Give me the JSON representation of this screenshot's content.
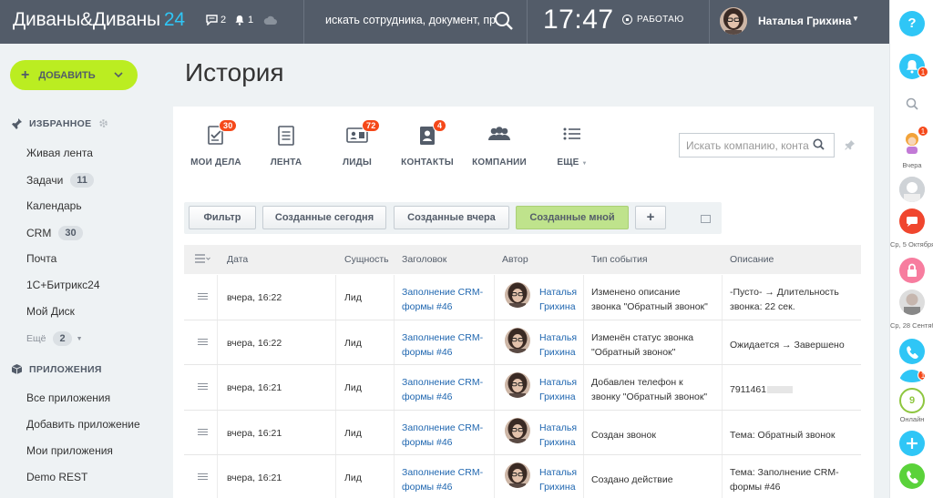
{
  "header": {
    "logo_text": "Диваны&Диваны",
    "logo_number": "24",
    "messages_count": "2",
    "notifications_count": "1",
    "search_placeholder": "искать сотрудника, документ, пр",
    "time": "17:47",
    "work_status": "РАБОТАЮ",
    "user_name": "Наталья Грихина",
    "help_label": "?"
  },
  "right_rail": {
    "notification_badge": "1",
    "chat_badge": "1",
    "label_yesterday": "Вчера",
    "label_date1": "Ср, 5 Октября",
    "label_date2": "Ср, 28 Сентября",
    "online_count": "9",
    "online_label": "Онлайн",
    "bottom_badge": "1"
  },
  "left_menu": {
    "add_label": "ДОБАВИТЬ",
    "favorites_label": "ИЗБРАННОЕ",
    "items": [
      {
        "label": "Живая лента",
        "count": ""
      },
      {
        "label": "Задачи",
        "count": "11"
      },
      {
        "label": "Календарь",
        "count": ""
      },
      {
        "label": "CRM",
        "count": "30"
      },
      {
        "label": "Почта",
        "count": ""
      },
      {
        "label": "1С+Битрикс24",
        "count": ""
      },
      {
        "label": "Мой Диск",
        "count": ""
      }
    ],
    "more_label": "Ещё",
    "more_count": "2",
    "apps_label": "ПРИЛОЖЕНИЯ",
    "apps": [
      {
        "label": "Все приложения"
      },
      {
        "label": "Добавить приложение"
      },
      {
        "label": "Мои приложения"
      },
      {
        "label": "Demo REST"
      }
    ]
  },
  "page_title": "История",
  "toolbar": [
    {
      "label": "МОИ ДЕЛА",
      "badge": "30",
      "icon": "tasks-icon"
    },
    {
      "label": "ЛЕНТА",
      "badge": "",
      "icon": "feed-icon"
    },
    {
      "label": "ЛИДЫ",
      "badge": "72",
      "icon": "leads-icon"
    },
    {
      "label": "КОНТАКТЫ",
      "badge": "4",
      "icon": "contacts-icon"
    },
    {
      "label": "КОМПАНИИ",
      "badge": "",
      "icon": "companies-icon"
    },
    {
      "label": "ЕЩЕ",
      "badge": "",
      "icon": "list-icon"
    }
  ],
  "company_search_placeholder": "Искать компанию, конта",
  "filters": [
    {
      "label": "Фильтр"
    },
    {
      "label": "Созданные сегодня"
    },
    {
      "label": "Созданные вчера"
    },
    {
      "label": "Созданные мной",
      "active": true
    }
  ],
  "filter_add_label": "+",
  "grid": {
    "columns": [
      "Дата",
      "Сущность",
      "Заголовок",
      "Автор",
      "Тип события",
      "Описание"
    ],
    "rows": [
      {
        "date": "вчера, 16:22",
        "entity": "Лид",
        "title_1": "Заполнение CRM-",
        "title_2": "формы #46",
        "author_1": "Наталья",
        "author_2": "Грихина",
        "event_1": "Изменено описание",
        "event_2": "звонка \"Обратный звонок\"",
        "desc_1": "-Пусто- → Длительность",
        "desc_2": "звонка: 22 сек."
      },
      {
        "date": "вчера, 16:22",
        "entity": "Лид",
        "title_1": "Заполнение CRM-",
        "title_2": "формы #46",
        "author_1": "Наталья",
        "author_2": "Грихина",
        "event_1": "Изменён статус звонка",
        "event_2": "\"Обратный звонок\"",
        "desc_1": "Ожидается → Завершено",
        "desc_2": ""
      },
      {
        "date": "вчера, 16:21",
        "entity": "Лид",
        "title_1": "Заполнение CRM-",
        "title_2": "формы #46",
        "author_1": "Наталья",
        "author_2": "Грихина",
        "event_1": "Добавлен телефон к",
        "event_2": "звонку \"Обратный звонок\"",
        "desc_1": "7911461",
        "desc_2": ""
      },
      {
        "date": "вчера, 16:21",
        "entity": "Лид",
        "title_1": "Заполнение CRM-",
        "title_2": "формы #46",
        "author_1": "Наталья",
        "author_2": "Грихина",
        "event_1": "Создан звонок",
        "event_2": "",
        "desc_1": "Тема: Обратный звонок",
        "desc_2": ""
      },
      {
        "date": "вчера, 16:21",
        "entity": "Лид",
        "title_1": "Заполнение CRM-",
        "title_2": "формы #46",
        "author_1": "Наталья",
        "author_2": "Грихина",
        "event_1": "Создано действие",
        "event_2": "",
        "desc_1": "Тема: Заполнение CRM-",
        "desc_2": "формы #46"
      }
    ]
  },
  "colors": {
    "header_bg": "#535c69",
    "accent_blue": "#2fc6f6",
    "add_button": "#bbed21",
    "badge_red": "#f54819",
    "active_filter": "#bfe38c",
    "link": "#2067b0"
  }
}
